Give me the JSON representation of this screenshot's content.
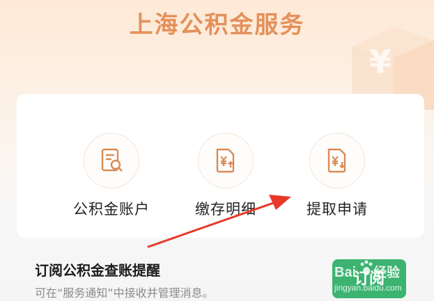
{
  "header": {
    "title": "上海公积金服务"
  },
  "decoration": {
    "yen_symbol": "¥"
  },
  "entries": [
    {
      "label": "公积金账户",
      "icon": "document-search-icon"
    },
    {
      "label": "缴存明细",
      "icon": "yen-document-upload-icon"
    },
    {
      "label": "提取申请",
      "icon": "yen-document-download-icon"
    }
  ],
  "subscribe": {
    "title": "订阅公积金查账提醒",
    "description": "可在“服务通知”中接收并管理消息。",
    "button_label": "订阅"
  },
  "watermark": {
    "brand": "Bai",
    "suffix": "经验",
    "url": "jingyan.baidu.com"
  },
  "colors": {
    "accent": "#e4905a",
    "icon": "#d98a55",
    "button": "#3cb371",
    "annotation_arrow": "#e8382a"
  }
}
